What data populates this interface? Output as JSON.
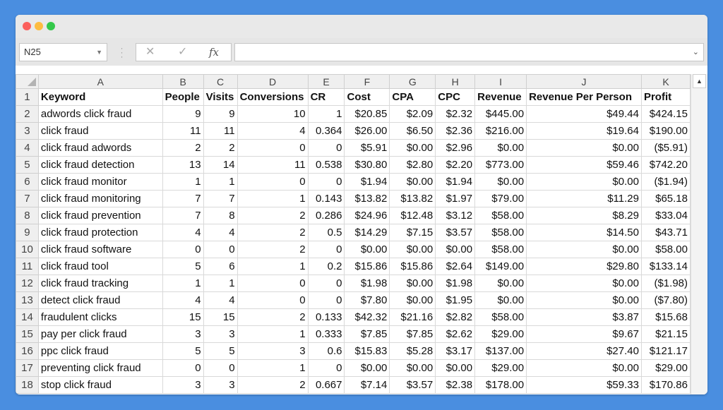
{
  "window": {
    "traffic_lights": [
      "close",
      "minimize",
      "zoom"
    ]
  },
  "formula_bar": {
    "name_box": "N25",
    "cancel_icon": "✕",
    "enter_icon": "✓",
    "fx_label": "fx",
    "formula_value": ""
  },
  "colors": {
    "negative": "#ff0000",
    "desktop": "#4a8ee0"
  },
  "columns": [
    "A",
    "B",
    "C",
    "D",
    "E",
    "F",
    "G",
    "H",
    "I",
    "J",
    "K"
  ],
  "row_numbers": [
    "1",
    "2",
    "3",
    "4",
    "5",
    "6",
    "7",
    "8",
    "9",
    "10",
    "11",
    "12",
    "13",
    "14",
    "15",
    "16",
    "17",
    "18"
  ],
  "headers": [
    "Keyword",
    "People",
    "Visits",
    "Conversions",
    "CR",
    "Cost",
    "CPA",
    "CPC",
    "Revenue",
    "Revenue Per Person",
    "Profit"
  ],
  "rows": [
    [
      "adwords click fraud",
      "9",
      "9",
      "10",
      "1",
      "$20.85",
      "$2.09",
      "$2.32",
      "$445.00",
      "$49.44",
      "$424.15"
    ],
    [
      "click fraud",
      "11",
      "11",
      "4",
      "0.364",
      "$26.00",
      "$6.50",
      "$2.36",
      "$216.00",
      "$19.64",
      "$190.00"
    ],
    [
      "click fraud adwords",
      "2",
      "2",
      "0",
      "0",
      "$5.91",
      "$0.00",
      "$2.96",
      "$0.00",
      "$0.00",
      "($5.91)"
    ],
    [
      "click fraud detection",
      "13",
      "14",
      "11",
      "0.538",
      "$30.80",
      "$2.80",
      "$2.20",
      "$773.00",
      "$59.46",
      "$742.20"
    ],
    [
      "click fraud monitor",
      "1",
      "1",
      "0",
      "0",
      "$1.94",
      "$0.00",
      "$1.94",
      "$0.00",
      "$0.00",
      "($1.94)"
    ],
    [
      "click fraud monitoring",
      "7",
      "7",
      "1",
      "0.143",
      "$13.82",
      "$13.82",
      "$1.97",
      "$79.00",
      "$11.29",
      "$65.18"
    ],
    [
      "click fraud prevention",
      "7",
      "8",
      "2",
      "0.286",
      "$24.96",
      "$12.48",
      "$3.12",
      "$58.00",
      "$8.29",
      "$33.04"
    ],
    [
      "click fraud protection",
      "4",
      "4",
      "2",
      "0.5",
      "$14.29",
      "$7.15",
      "$3.57",
      "$58.00",
      "$14.50",
      "$43.71"
    ],
    [
      "click fraud software",
      "0",
      "0",
      "2",
      "0",
      "$0.00",
      "$0.00",
      "$0.00",
      "$58.00",
      "$0.00",
      "$58.00"
    ],
    [
      "click fraud tool",
      "5",
      "6",
      "1",
      "0.2",
      "$15.86",
      "$15.86",
      "$2.64",
      "$149.00",
      "$29.80",
      "$133.14"
    ],
    [
      "click fraud tracking",
      "1",
      "1",
      "0",
      "0",
      "$1.98",
      "$0.00",
      "$1.98",
      "$0.00",
      "$0.00",
      "($1.98)"
    ],
    [
      "detect click fraud",
      "4",
      "4",
      "0",
      "0",
      "$7.80",
      "$0.00",
      "$1.95",
      "$0.00",
      "$0.00",
      "($7.80)"
    ],
    [
      "fraudulent clicks",
      "15",
      "15",
      "2",
      "0.133",
      "$42.32",
      "$21.16",
      "$2.82",
      "$58.00",
      "$3.87",
      "$15.68"
    ],
    [
      "pay per click fraud",
      "3",
      "3",
      "1",
      "0.333",
      "$7.85",
      "$7.85",
      "$2.62",
      "$29.00",
      "$9.67",
      "$21.15"
    ],
    [
      "ppc click fraud",
      "5",
      "5",
      "3",
      "0.6",
      "$15.83",
      "$5.28",
      "$3.17",
      "$137.00",
      "$27.40",
      "$121.17"
    ],
    [
      "preventing click fraud",
      "0",
      "0",
      "1",
      "0",
      "$0.00",
      "$0.00",
      "$0.00",
      "$29.00",
      "$0.00",
      "$29.00"
    ],
    [
      "stop click fraud",
      "3",
      "3",
      "2",
      "0.667",
      "$7.14",
      "$3.57",
      "$2.38",
      "$178.00",
      "$59.33",
      "$170.86"
    ]
  ]
}
